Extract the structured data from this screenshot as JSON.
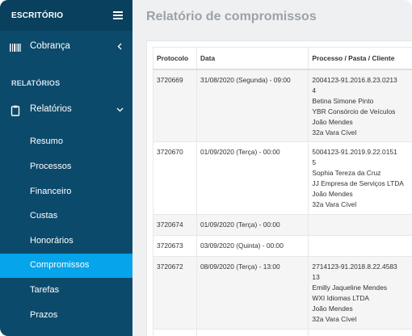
{
  "sidebar": {
    "title": "ESCRITÓRIO",
    "cobranca_label": "Cobrança",
    "section_label": "RELATÓRIOS",
    "relatorios_label": "Relatórios",
    "sub_items": [
      "Resumo",
      "Processos",
      "Financeiro",
      "Custas",
      "Honorários",
      "Compromissos",
      "Tarefas",
      "Prazos"
    ],
    "active_item": "Compromissos",
    "accent_color": "#05a4eb",
    "background_color": "#0c4a6b"
  },
  "main": {
    "title": "Relatório de compromissos",
    "columns": [
      "Protocolo",
      "Data",
      "Processo / Pasta / Cliente"
    ],
    "rows": [
      {
        "protocolo": "3720669",
        "data": "31/08/2020 (Segunda) - 09:00",
        "processo": [
          "2004123-91.2016.8.23.0213",
          "4",
          "Betina Simone Pinto",
          "YBR Consórcio de Veículos",
          "João Mendes",
          "32a Vara Cível"
        ]
      },
      {
        "protocolo": "3720670",
        "data": "01/09/2020 (Terça) - 00:00",
        "processo": [
          "5004123-91.2019.9.22.0151",
          "5",
          "Sophia Tereza da Cruz",
          "JJ Empresa de Serviços LTDA",
          "João Mendes",
          "32a Vara Cível"
        ]
      },
      {
        "protocolo": "3720674",
        "data": "01/09/2020 (Terça) - 00:00",
        "processo": []
      },
      {
        "protocolo": "3720673",
        "data": "03/09/2020 (Quinta) - 00:00",
        "processo": []
      },
      {
        "protocolo": "3720672",
        "data": "08/09/2020 (Terça) - 13:00",
        "processo": [
          "2714123-91.2018.8.22.4583",
          "13",
          "Emilly Jaqueline Mendes",
          "WXI Idiomas LTDA",
          "João Mendes",
          "32a Vara Cível"
        ]
      }
    ]
  }
}
